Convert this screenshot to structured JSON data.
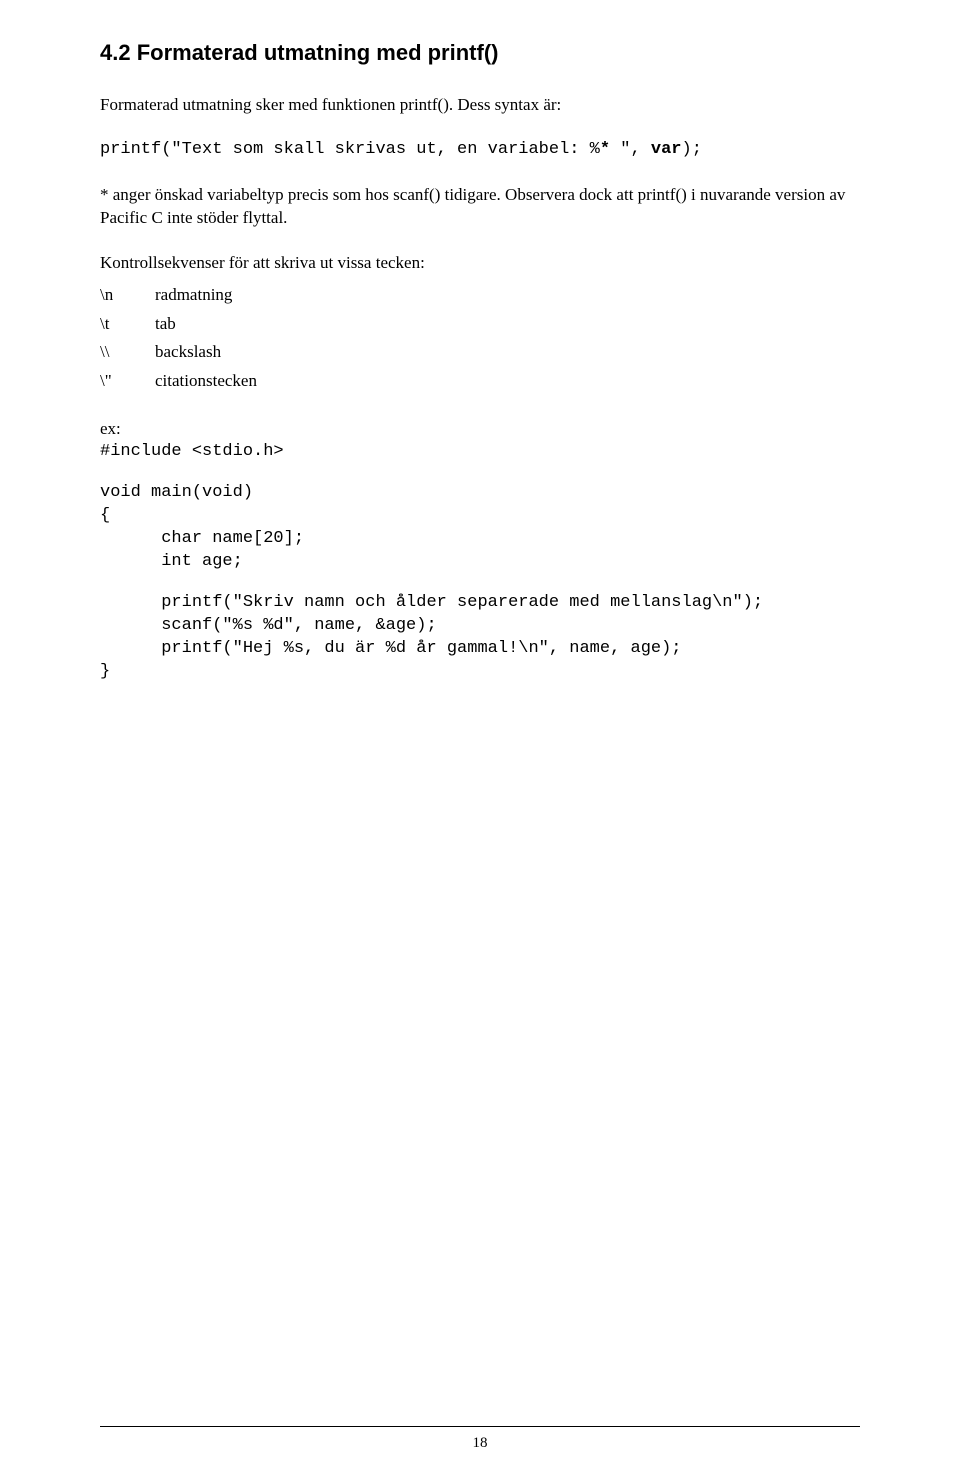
{
  "heading": "4.2 Formaterad utmatning med printf()",
  "para1": "Formaterad utmatning sker med funktionen printf(). Dess syntax är:",
  "syntax_line": "printf(\"Text som skall skrivas ut, en variabel: %* \", var);",
  "para2": "* anger önskad variabeltyp precis som hos scanf() tidigare. Observera dock att printf() i nuvarande version av Pacific C inte stöder flyttal.",
  "para3": "Kontrollsekvenser för att skriva ut vissa tecken:",
  "list": [
    {
      "key": "\\n",
      "val": "radmatning"
    },
    {
      "key": "\\t",
      "val": "tab"
    },
    {
      "key": "\\\\",
      "val": "backslash"
    },
    {
      "key": "\\\"",
      "val": "citationstecken"
    }
  ],
  "ex_label": "ex:",
  "code": {
    "line1": "#include <stdio.h>",
    "line2": "void main(void)",
    "line3": "{",
    "line4": "      char name[20];",
    "line5": "      int age;",
    "line6": "      printf(\"Skriv namn och ålder separerade med mellanslag\\n\");",
    "line7": "      scanf(\"%s %d\", name, &age);",
    "line8": "      printf(\"Hej %s, du är %d år gammal!\\n\", name, age);",
    "line9": "}"
  },
  "page_number": "18"
}
